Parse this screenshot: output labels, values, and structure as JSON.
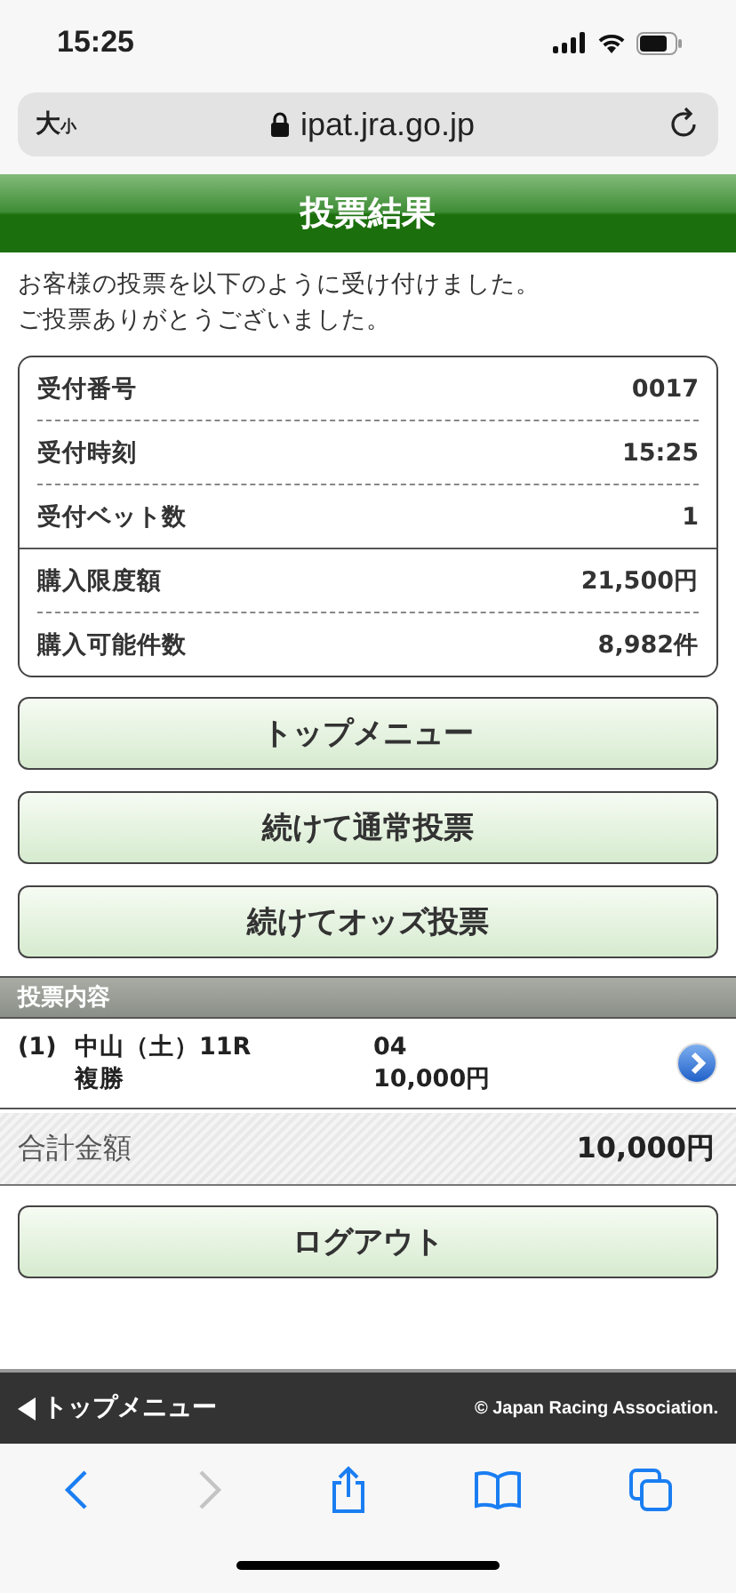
{
  "status_bar": {
    "time": "15:25"
  },
  "browser": {
    "text_size": "大",
    "text_size_small": "小",
    "url": "ipat.jra.go.jp"
  },
  "header": {
    "title": "投票結果"
  },
  "message": [
    "お客様の投票を以下のように受け付けました。",
    "ご投票ありがとうございました。"
  ],
  "info_groups": [
    [
      {
        "label": "受付番号",
        "value": "0017"
      },
      {
        "label": "受付時刻",
        "value": "15:25"
      },
      {
        "label": "受付ベット数",
        "value": "1"
      }
    ],
    [
      {
        "label": "購入限度額",
        "value": "21,500円"
      },
      {
        "label": "購入可能件数",
        "value": "8,982件"
      }
    ]
  ],
  "buttons": [
    "トップメニュー",
    "続けて通常投票",
    "続けてオッズ投票"
  ],
  "bets_section": {
    "title": "投票内容",
    "bets": [
      {
        "number": "(1)",
        "race": "中山（土）11R",
        "type": "複勝",
        "selection": "04",
        "amount": "10,000円"
      }
    ]
  },
  "total": {
    "label": "合計金額",
    "value": "10,000円"
  },
  "logout": "ログアウト",
  "footer": {
    "back_link": "トップメニュー",
    "copyright": "© Japan Racing Association."
  },
  "toolbar": [
    {
      "kind": "back",
      "disabled": false
    },
    {
      "kind": "forward",
      "disabled": true
    },
    {
      "kind": "share",
      "disabled": false
    },
    {
      "kind": "bookmarks",
      "disabled": false
    },
    {
      "kind": "tabs",
      "disabled": false
    }
  ]
}
